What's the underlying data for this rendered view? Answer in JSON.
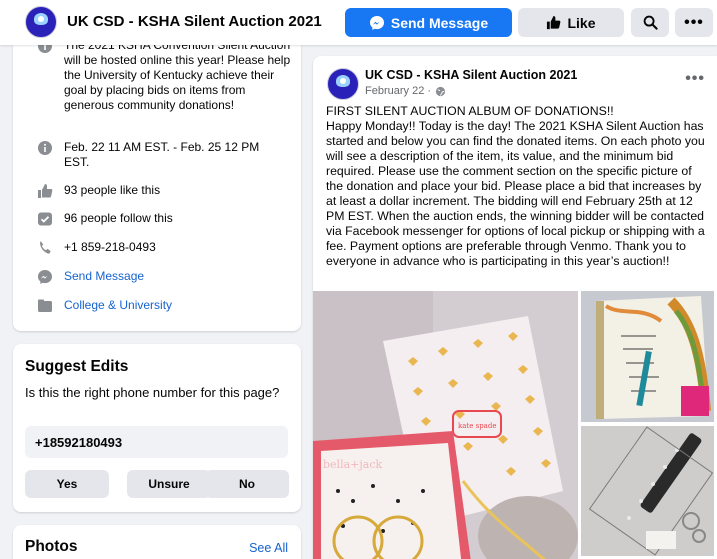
{
  "header": {
    "page_name": "UK CSD - KSHA Silent Auction 2021",
    "send_message": "Send Message",
    "like": "Like"
  },
  "about": {
    "description": "The 2021 KSHA Convention Silent Auction will be hosted online this year! Please help the University of Kentucky achieve their goal by placing bids on items from generous community donations!",
    "dates": "Feb. 22 11 AM EST. - Feb. 25 12 PM EST.",
    "likes": "93 people like this",
    "follows": "96 people follow this",
    "phone": "+1 859-218-0493",
    "message": "Send Message",
    "category": "College & University"
  },
  "suggest": {
    "title": "Suggest Edits",
    "question": "Is this the right phone number for this page?",
    "phone_value": "+18592180493",
    "yes": "Yes",
    "unsure": "Unsure",
    "no": "No"
  },
  "photos": {
    "title": "Photos",
    "see_all": "See All"
  },
  "post": {
    "author": "UK CSD - KSHA Silent Auction 2021",
    "date": "February 22 · ",
    "body_title": "FIRST SILENT AUCTION ALBUM OF DONATIONS!!",
    "body": "Happy Monday!! Today is the day! The 2021 KSHA Silent Auction has started and below you can find the donated items. On each photo you will see a description of the item, its value, and the minimum bid required. Please use the comment section on the specific picture of the donation and place your bid. Please place a bid that increases by at least a dollar increment. The bidding will end February 25th at 12 PM EST. When the auction ends, the winning bidder will be contacted via Facebook messenger for options of local pickup or shipping with a fee. Payment options are preferable through Venmo. Thank you to everyone in advance who is participating in this year’s auction!!",
    "box_brand": "kate spade",
    "bracelet_brand": "bella+jack"
  },
  "colors": {
    "brand_blue": "#1877f2",
    "link_blue": "#1763cf",
    "page_bg": "#f0f2f5"
  }
}
